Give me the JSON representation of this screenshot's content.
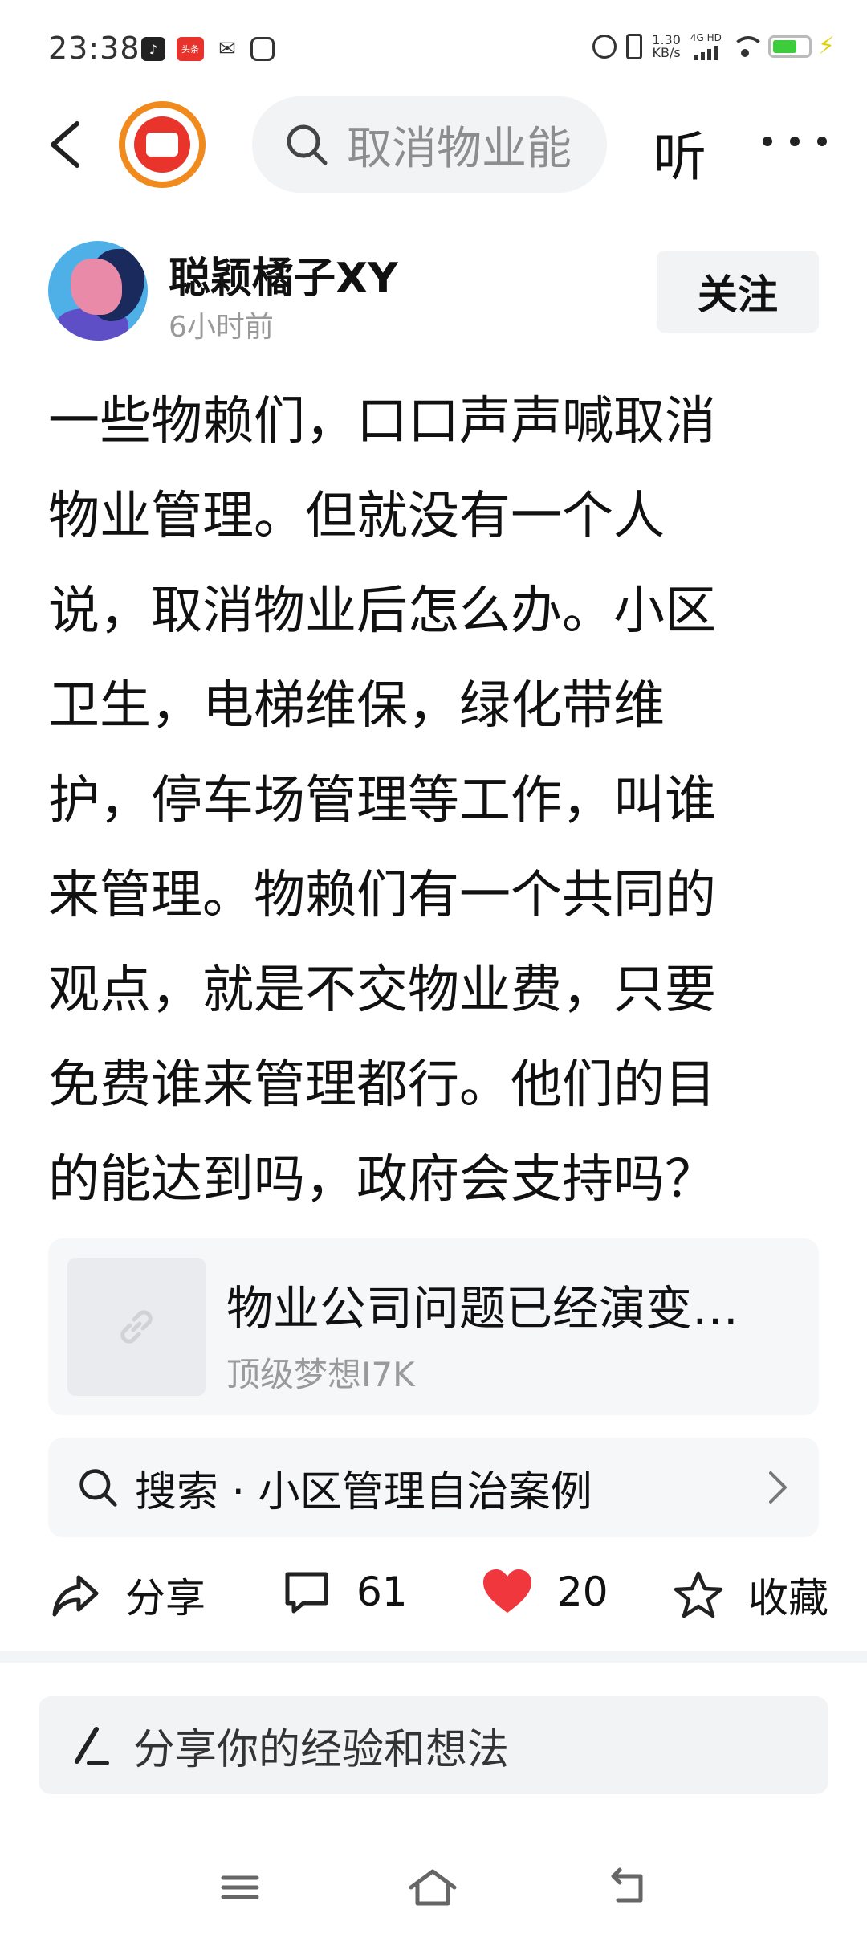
{
  "status_bar": {
    "time": "23:38",
    "app_badge_toutiao": "头条",
    "net_speed_value": "1.30",
    "net_speed_unit": "KB/s",
    "network_type": "4G HD",
    "battery_level": 0.7
  },
  "top_nav": {
    "search_text": "取消物业能",
    "listen_label": "听"
  },
  "author": {
    "name": "聪颖橘子XY",
    "time": "6小时前",
    "follow_label": "关注"
  },
  "post": {
    "lines": [
      "一些物赖们，口口声声喊取消",
      "物业管理。但就没有一个人",
      "说，取消物业后怎么办。小区",
      "卫生，电梯维保，绿化带维",
      "护，停车场管理等工作，叫谁",
      "来管理。物赖们有一个共同的",
      "观点，就是不交物业费，只要",
      "免费谁来管理都行。他们的目",
      "的能达到吗，政府会支持吗？"
    ]
  },
  "link_card": {
    "title": "物业公司问题已经演变…",
    "source": "顶级梦想I7K"
  },
  "search_suggestion": {
    "text": "搜索 · 小区管理自治案例"
  },
  "actions": {
    "share_label": "分享",
    "comment_count": "61",
    "like_count": "20",
    "favorite_label": "收藏",
    "like_color": "#f0373d"
  },
  "comment_box": {
    "placeholder": "分享你的经验和想法"
  }
}
